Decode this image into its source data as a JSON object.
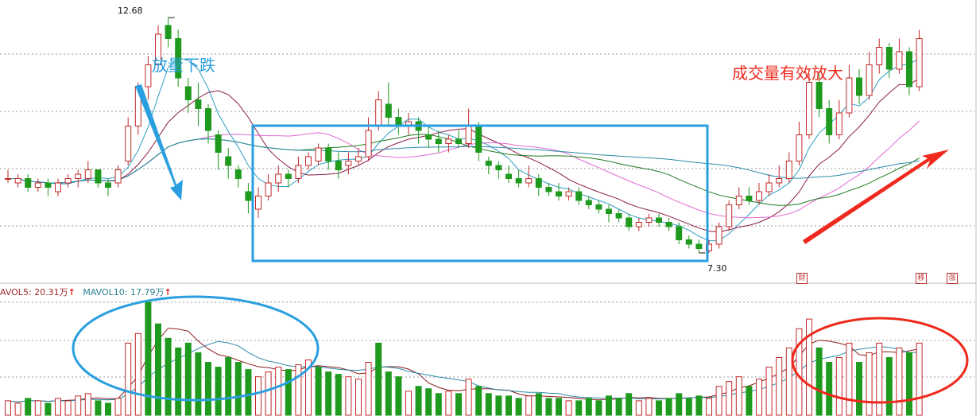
{
  "annotations": {
    "left_text": "放量下跌",
    "right_text": "成交量有效放大"
  },
  "price_labels": {
    "high": "12.68",
    "low": "7.30"
  },
  "volume_legend": {
    "ma5": "AVOL5: 20.31万",
    "ma10": "MAVOL10: 17.79万",
    "arrow": "↑"
  },
  "event_tags": [
    {
      "label": "财"
    },
    {
      "label": "移"
    },
    {
      "label": "涨"
    }
  ],
  "colors": {
    "up": "#c0282a",
    "down": "#1f9a1f",
    "box_blue": "#2a9fe0",
    "annotation_red": "#ee2a1e",
    "ma5": "#2a9fc0",
    "ma10": "#8a1c4a",
    "ma20": "#e26ad4",
    "ma30": "#1f7a1f",
    "ma60": "#2a8aa8"
  },
  "chart_data": {
    "type": "candlestick",
    "price_range": [
      6.9,
      12.9
    ],
    "candles": [
      [
        9.0,
        9.0,
        9.2,
        8.9,
        "up"
      ],
      [
        8.9,
        9.0,
        9.1,
        8.8,
        "up"
      ],
      [
        9.0,
        8.8,
        9.1,
        8.7,
        "down"
      ],
      [
        8.8,
        8.9,
        9.0,
        8.7,
        "up"
      ],
      [
        8.9,
        8.8,
        9.0,
        8.6,
        "down"
      ],
      [
        8.7,
        8.9,
        9.0,
        8.6,
        "up"
      ],
      [
        8.9,
        9.0,
        9.1,
        8.8,
        "up"
      ],
      [
        9.0,
        9.1,
        9.2,
        8.8,
        "up"
      ],
      [
        9.0,
        9.2,
        9.4,
        8.9,
        "up"
      ],
      [
        9.2,
        8.9,
        9.2,
        8.8,
        "down"
      ],
      [
        8.9,
        8.8,
        9.0,
        8.6,
        "down"
      ],
      [
        8.9,
        9.2,
        9.3,
        8.8,
        "up"
      ],
      [
        9.4,
        10.2,
        10.4,
        9.3,
        "up"
      ],
      [
        10.2,
        11.1,
        11.2,
        10.0,
        "up"
      ],
      [
        11.1,
        11.6,
        11.8,
        10.8,
        "up"
      ],
      [
        11.6,
        12.3,
        12.5,
        11.5,
        "up"
      ],
      [
        12.2,
        12.5,
        12.68,
        12.0,
        "down"
      ],
      [
        12.2,
        11.3,
        12.4,
        11.1,
        "down"
      ],
      [
        11.1,
        10.8,
        11.3,
        10.5,
        "down"
      ],
      [
        10.8,
        10.6,
        11.2,
        10.2,
        "down"
      ],
      [
        10.6,
        10.1,
        10.7,
        9.8,
        "down"
      ],
      [
        10.0,
        9.6,
        10.1,
        9.2,
        "down"
      ],
      [
        9.5,
        9.3,
        9.7,
        9.0,
        "down"
      ],
      [
        9.2,
        9.0,
        9.3,
        8.8,
        "down"
      ],
      [
        8.7,
        8.5,
        8.9,
        8.2,
        "down"
      ],
      [
        8.3,
        8.6,
        8.8,
        8.1,
        "up"
      ],
      [
        8.6,
        8.9,
        9.1,
        8.5,
        "up"
      ],
      [
        8.9,
        9.1,
        9.3,
        8.7,
        "up"
      ],
      [
        9.1,
        9.0,
        9.2,
        8.8,
        "down"
      ],
      [
        9.0,
        9.3,
        9.5,
        8.9,
        "up"
      ],
      [
        9.3,
        9.5,
        9.6,
        9.2,
        "up"
      ],
      [
        9.4,
        9.7,
        9.8,
        9.3,
        "up"
      ],
      [
        9.7,
        9.4,
        9.8,
        9.2,
        "down"
      ],
      [
        9.4,
        9.2,
        9.6,
        9.0,
        "down"
      ],
      [
        9.3,
        9.4,
        9.6,
        9.1,
        "up"
      ],
      [
        9.4,
        9.5,
        9.7,
        9.3,
        "up"
      ],
      [
        9.5,
        10.1,
        10.4,
        9.4,
        "up"
      ],
      [
        10.2,
        10.8,
        11.0,
        10.1,
        "up"
      ],
      [
        10.7,
        10.4,
        11.2,
        10.2,
        "down"
      ],
      [
        10.4,
        10.2,
        10.6,
        10.0,
        "down"
      ],
      [
        10.2,
        10.3,
        10.5,
        10.0,
        "up"
      ],
      [
        10.3,
        10.1,
        10.4,
        9.8,
        "down"
      ],
      [
        10.0,
        9.9,
        10.2,
        9.7,
        "down"
      ],
      [
        9.9,
        9.8,
        10.1,
        9.6,
        "down"
      ],
      [
        9.8,
        9.9,
        10.0,
        9.6,
        "up"
      ],
      [
        9.9,
        9.8,
        10.1,
        9.7,
        "down"
      ],
      [
        9.8,
        10.2,
        10.6,
        9.7,
        "up"
      ],
      [
        10.2,
        9.6,
        10.3,
        9.4,
        "down"
      ],
      [
        9.4,
        9.3,
        9.5,
        9.1,
        "down"
      ],
      [
        9.3,
        9.2,
        9.4,
        9.0,
        "down"
      ],
      [
        9.1,
        9.0,
        9.3,
        8.9,
        "down"
      ],
      [
        9.0,
        8.9,
        9.2,
        8.8,
        "down"
      ],
      [
        8.9,
        9.0,
        9.3,
        8.8,
        "up"
      ],
      [
        9.0,
        8.8,
        9.1,
        8.6,
        "down"
      ],
      [
        8.8,
        8.7,
        8.9,
        8.6,
        "down"
      ],
      [
        8.7,
        8.6,
        8.9,
        8.5,
        "down"
      ],
      [
        8.6,
        8.7,
        8.8,
        8.5,
        "up"
      ],
      [
        8.7,
        8.5,
        8.8,
        8.4,
        "down"
      ],
      [
        8.5,
        8.4,
        8.6,
        8.3,
        "down"
      ],
      [
        8.4,
        8.3,
        8.5,
        8.2,
        "down"
      ],
      [
        8.3,
        8.2,
        8.4,
        8.0,
        "down"
      ],
      [
        8.2,
        8.1,
        8.3,
        8.0,
        "down"
      ],
      [
        8.1,
        7.9,
        8.2,
        7.8,
        "down"
      ],
      [
        7.9,
        8.0,
        8.1,
        7.8,
        "up"
      ],
      [
        8.0,
        8.1,
        8.2,
        7.9,
        "up"
      ],
      [
        8.1,
        8.0,
        8.2,
        7.9,
        "down"
      ],
      [
        8.0,
        7.9,
        8.1,
        7.8,
        "down"
      ],
      [
        7.9,
        7.6,
        8.0,
        7.5,
        "down"
      ],
      [
        7.6,
        7.5,
        7.7,
        7.4,
        "down"
      ],
      [
        7.5,
        7.4,
        7.6,
        7.3,
        "down"
      ],
      [
        7.35,
        7.5,
        7.6,
        7.3,
        "up"
      ],
      [
        7.5,
        7.9,
        8.0,
        7.4,
        "up"
      ],
      [
        7.9,
        8.4,
        8.5,
        7.8,
        "up"
      ],
      [
        8.4,
        8.6,
        8.8,
        8.3,
        "up"
      ],
      [
        8.6,
        8.5,
        8.8,
        8.4,
        "down"
      ],
      [
        8.5,
        8.7,
        8.9,
        8.4,
        "up"
      ],
      [
        8.7,
        8.9,
        9.1,
        8.6,
        "up"
      ],
      [
        8.9,
        9.0,
        9.3,
        8.8,
        "up"
      ],
      [
        9.0,
        9.4,
        9.6,
        8.9,
        "up"
      ],
      [
        9.4,
        10.0,
        10.3,
        9.3,
        "up"
      ],
      [
        10.0,
        11.2,
        11.4,
        9.9,
        "up"
      ],
      [
        11.2,
        10.6,
        11.4,
        10.4,
        "down"
      ],
      [
        10.6,
        10.0,
        10.8,
        9.8,
        "down"
      ],
      [
        10.0,
        10.5,
        10.8,
        9.9,
        "up"
      ],
      [
        10.5,
        11.3,
        11.6,
        10.4,
        "up"
      ],
      [
        11.3,
        10.9,
        11.5,
        10.7,
        "down"
      ],
      [
        10.9,
        11.6,
        11.9,
        10.8,
        "up"
      ],
      [
        11.6,
        12.0,
        12.2,
        11.4,
        "up"
      ],
      [
        12.0,
        11.5,
        12.1,
        11.3,
        "down"
      ],
      [
        11.5,
        11.9,
        12.2,
        11.4,
        "up"
      ],
      [
        11.9,
        11.1,
        12.0,
        10.9,
        "down"
      ],
      [
        11.1,
        12.2,
        12.4,
        11.0,
        "up"
      ]
    ],
    "volumes": [
      [
        6,
        "up"
      ],
      [
        5,
        "up"
      ],
      [
        7,
        "down"
      ],
      [
        6,
        "up"
      ],
      [
        5,
        "down"
      ],
      [
        7,
        "up"
      ],
      [
        6,
        "up"
      ],
      [
        8,
        "up"
      ],
      [
        9,
        "up"
      ],
      [
        6,
        "down"
      ],
      [
        5,
        "down"
      ],
      [
        7,
        "up"
      ],
      [
        30,
        "up"
      ],
      [
        34,
        "up"
      ],
      [
        47,
        "down"
      ],
      [
        38,
        "down"
      ],
      [
        32,
        "down"
      ],
      [
        28,
        "down"
      ],
      [
        30,
        "down"
      ],
      [
        26,
        "down"
      ],
      [
        22,
        "down"
      ],
      [
        20,
        "down"
      ],
      [
        24,
        "down"
      ],
      [
        22,
        "down"
      ],
      [
        19,
        "down"
      ],
      [
        16,
        "up"
      ],
      [
        18,
        "up"
      ],
      [
        20,
        "up"
      ],
      [
        19,
        "down"
      ],
      [
        21,
        "up"
      ],
      [
        23,
        "up"
      ],
      [
        20,
        "down"
      ],
      [
        18,
        "down"
      ],
      [
        17,
        "down"
      ],
      [
        16,
        "up"
      ],
      [
        15,
        "up"
      ],
      [
        22,
        "up"
      ],
      [
        30,
        "down"
      ],
      [
        18,
        "down"
      ],
      [
        16,
        "down"
      ],
      [
        10,
        "up"
      ],
      [
        12,
        "down"
      ],
      [
        11,
        "down"
      ],
      [
        9,
        "down"
      ],
      [
        10,
        "up"
      ],
      [
        9,
        "down"
      ],
      [
        15,
        "up"
      ],
      [
        12,
        "down"
      ],
      [
        9,
        "down"
      ],
      [
        8,
        "down"
      ],
      [
        8,
        "down"
      ],
      [
        7,
        "down"
      ],
      [
        8,
        "up"
      ],
      [
        9,
        "down"
      ],
      [
        7,
        "down"
      ],
      [
        7,
        "down"
      ],
      [
        6,
        "up"
      ],
      [
        6,
        "down"
      ],
      [
        7,
        "down"
      ],
      [
        6,
        "down"
      ],
      [
        8,
        "down"
      ],
      [
        7,
        "down"
      ],
      [
        9,
        "down"
      ],
      [
        6,
        "up"
      ],
      [
        7,
        "up"
      ],
      [
        6,
        "down"
      ],
      [
        7,
        "down"
      ],
      [
        9,
        "down"
      ],
      [
        7,
        "down"
      ],
      [
        8,
        "down"
      ],
      [
        7,
        "up"
      ],
      [
        12,
        "up"
      ],
      [
        14,
        "up"
      ],
      [
        16,
        "up"
      ],
      [
        12,
        "down"
      ],
      [
        15,
        "up"
      ],
      [
        20,
        "up"
      ],
      [
        24,
        "up"
      ],
      [
        28,
        "up"
      ],
      [
        36,
        "up"
      ],
      [
        40,
        "up"
      ],
      [
        28,
        "down"
      ],
      [
        22,
        "down"
      ],
      [
        24,
        "up"
      ],
      [
        30,
        "up"
      ],
      [
        22,
        "down"
      ],
      [
        26,
        "up"
      ],
      [
        30,
        "up"
      ],
      [
        24,
        "down"
      ],
      [
        28,
        "up"
      ],
      [
        26,
        "down"
      ],
      [
        30,
        "up"
      ]
    ]
  }
}
